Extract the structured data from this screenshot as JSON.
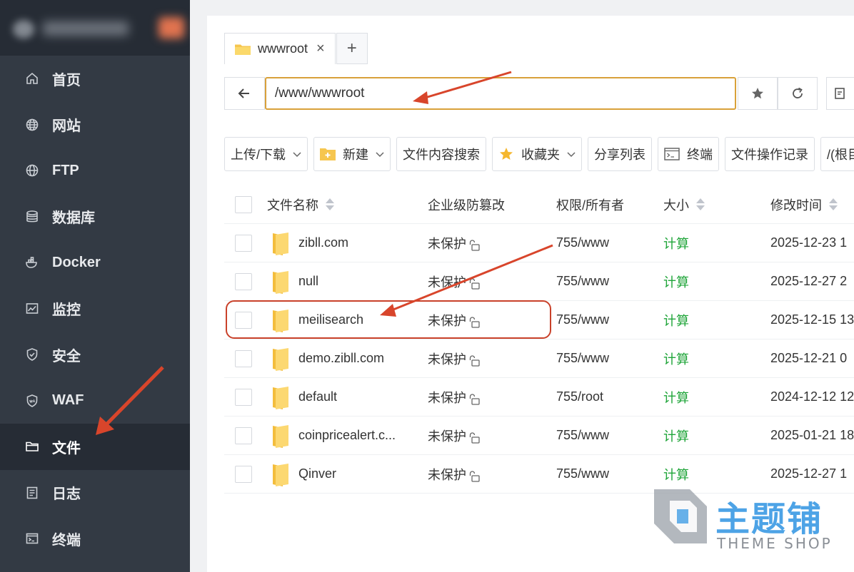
{
  "sidebar": {
    "items": [
      {
        "label": "首页",
        "icon": "home-icon"
      },
      {
        "label": "网站",
        "icon": "globe-icon"
      },
      {
        "label": "FTP",
        "icon": "ftp-globe-icon"
      },
      {
        "label": "数据库",
        "icon": "database-icon"
      },
      {
        "label": "Docker",
        "icon": "docker-icon"
      },
      {
        "label": "监控",
        "icon": "monitor-icon"
      },
      {
        "label": "安全",
        "icon": "shield-icon"
      },
      {
        "label": "WAF",
        "icon": "waf-shield-icon"
      },
      {
        "label": "文件",
        "icon": "folder-icon",
        "active": true
      },
      {
        "label": "日志",
        "icon": "log-icon"
      },
      {
        "label": "终端",
        "icon": "terminal-icon"
      }
    ]
  },
  "tab": {
    "label": "wwwroot",
    "close": "×",
    "add": "+"
  },
  "address": {
    "value": "/www/wwwroot"
  },
  "toolbar": {
    "upload": "上传/下载",
    "new": "新建",
    "search": "文件内容搜索",
    "favorites": "收藏夹",
    "share": "分享列表",
    "terminal": "终端",
    "oplog": "文件操作记录",
    "root": "/(根目录"
  },
  "table": {
    "headers": {
      "name": "文件名称",
      "protect": "企业级防篡改",
      "perm": "权限/所有者",
      "size": "大小",
      "mtime": "修改时间"
    },
    "rows": [
      {
        "name": "zibll.com",
        "protect": "未保护",
        "perm": "755/www",
        "size": "计算",
        "mtime": "2025-12-23 1"
      },
      {
        "name": "null",
        "protect": "未保护",
        "perm": "755/www",
        "size": "计算",
        "mtime": "2025-12-27 2"
      },
      {
        "name": "meilisearch",
        "protect": "未保护",
        "perm": "755/www",
        "size": "计算",
        "mtime": "2025-12-15 13"
      },
      {
        "name": "demo.zibll.com",
        "protect": "未保护",
        "perm": "755/www",
        "size": "计算",
        "mtime": "2025-12-21 0"
      },
      {
        "name": "default",
        "protect": "未保护",
        "perm": "755/root",
        "size": "计算",
        "mtime": "2024-12-12 12"
      },
      {
        "name": "coinpricealert.c...",
        "protect": "未保护",
        "perm": "755/www",
        "size": "计算",
        "mtime": "2025-01-21 18"
      },
      {
        "name": "Qinver",
        "protect": "未保护",
        "perm": "755/www",
        "size": "计算",
        "mtime": "2025-12-27 1"
      }
    ]
  },
  "watermark": {
    "title": "主题铺",
    "subtitle": "THEME SHOP"
  },
  "colors": {
    "accent": "#20a53a",
    "address_border": "#d9a13a",
    "annotation": "#d8452b",
    "sidebar_bg": "#333a44"
  }
}
